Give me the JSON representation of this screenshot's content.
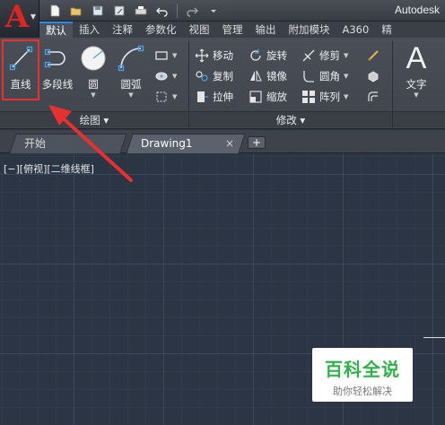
{
  "app": {
    "title": "Autodesk",
    "logo_letter": "A"
  },
  "ribbon_tabs": [
    "默认",
    "插入",
    "注释",
    "参数化",
    "视图",
    "管理",
    "输出",
    "附加模块",
    "A360",
    "精"
  ],
  "draw_panel": {
    "title": "绘图 ▾",
    "tools": {
      "line": "直线",
      "polyline": "多段线",
      "circle": "圆",
      "arc": "圆弧"
    }
  },
  "modify_panel": {
    "title": "修改 ▾",
    "tools": {
      "move": "移动",
      "rotate": "旋转",
      "trim": "修剪",
      "copy": "复制",
      "mirror": "镜像",
      "fillet": "圆角",
      "stretch": "拉伸",
      "scale": "缩放",
      "array": "阵列"
    }
  },
  "annotation": {
    "text_label": "文字",
    "text_glyph": "A"
  },
  "doc_tabs": {
    "start": "开始",
    "drawing": "Drawing1",
    "close": "×",
    "new": "+"
  },
  "viewport": {
    "label": "[−][俯视][二维线框]"
  },
  "watermark": {
    "main": "百科全说",
    "sub": "助你轻松解决"
  },
  "colors": {
    "canvas_bg": "#2b3544",
    "highlight": "#e8312f",
    "accent_tab": "#2c8de0",
    "watermark_green": "#2fb24a"
  }
}
